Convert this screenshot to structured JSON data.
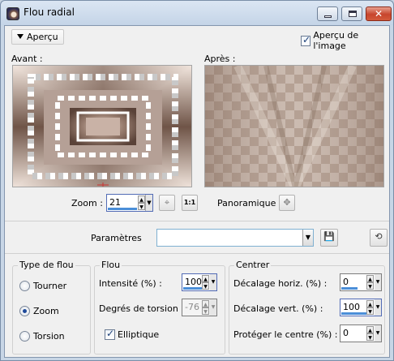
{
  "window": {
    "title": "Flou radial",
    "close_glyph": "✕"
  },
  "top": {
    "preview_toggle": "Aperçu",
    "image_preview_label": "Aperçu de l'image",
    "image_preview_checked": true
  },
  "preview": {
    "before_label": "Avant :",
    "after_label": "Après :",
    "zoom_label": "Zoom :",
    "zoom_value": "21",
    "zoom_fit_icon": "crosshair-icon",
    "zoom_100_label": "1:1",
    "pan_label": "Panoramique :",
    "pan_icon": "move-icon",
    "colors": {
      "brown_dark": "#6f5447",
      "brown_light": "#f1e5dd",
      "checker_gray": "#c8c8c8"
    }
  },
  "params": {
    "label": "Paramètres",
    "value": "",
    "save_icon": "floppy-disk-icon",
    "reset_icon": "reset-icon"
  },
  "blur_type": {
    "title": "Type de flou",
    "options": [
      {
        "label": "Tourner",
        "selected": false
      },
      {
        "label": "Zoom",
        "selected": true
      },
      {
        "label": "Torsion",
        "selected": false
      }
    ]
  },
  "blur": {
    "title": "Flou",
    "intensity_label": "Intensité (%) :",
    "intensity_value": "100",
    "twist_label": "Degrés de torsion :",
    "twist_value": "-76",
    "elliptic_label": "Elliptique",
    "elliptic_checked": true
  },
  "center": {
    "title": "Centrer",
    "h_offset_label": "Décalage horiz. (%) :",
    "h_offset_value": "0",
    "v_offset_label": "Décalage vert. (%) :",
    "v_offset_value": "100",
    "protect_label": "Protéger le centre (%) :",
    "protect_value": "0"
  }
}
